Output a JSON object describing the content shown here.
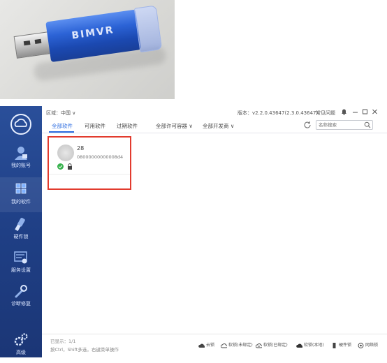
{
  "photo": {
    "brand_text": "BIMVR"
  },
  "sidebar": {
    "items": [
      {
        "label": "我的账号",
        "icon": "user-icon"
      },
      {
        "label": "我的软件",
        "icon": "cube-icon"
      },
      {
        "label": "硬件锁",
        "icon": "key-icon"
      },
      {
        "label": "服务设置",
        "icon": "settings-panel-icon"
      },
      {
        "label": "诊断修复",
        "icon": "wrench-icon"
      },
      {
        "label": "高级",
        "icon": "gears-icon"
      }
    ]
  },
  "topbar": {
    "region": "区域：中国 ∨",
    "version": "版本：v2.2.0.43647(2.3.0.43647)",
    "faq": "常见问题"
  },
  "tabs": {
    "items": [
      "全部软件",
      "可用软件",
      "过期软件"
    ],
    "filters": [
      "全部许可容器 ∨",
      "全部开发商 ∨"
    ]
  },
  "search": {
    "placeholder": "名称搜索"
  },
  "card": {
    "name": "28",
    "serial": "08000000000008d4"
  },
  "footer": {
    "count": "已显示：1/1",
    "hint": "按Ctrl，Shift多选，右键菜单操作",
    "buttons": [
      "云锁",
      "软锁(未绑定)",
      "软锁(已绑定)",
      "软锁(本地)",
      "硬件锁",
      "网络锁"
    ]
  },
  "colors": {
    "sidebar": "#1f3f85",
    "accent": "#2b6be0",
    "highlight": "#e23b2e",
    "ok": "#37b24d"
  }
}
